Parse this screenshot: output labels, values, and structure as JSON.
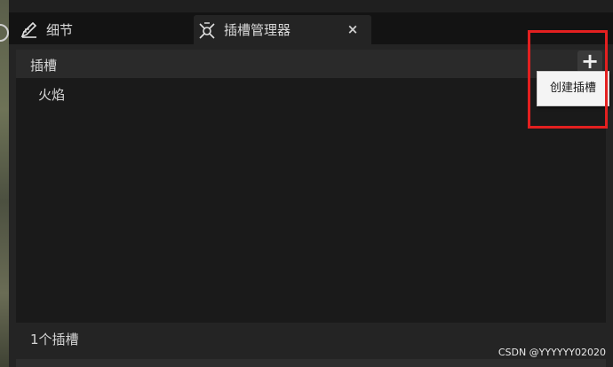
{
  "tabs": [
    {
      "label": "细节",
      "icon": "pencil-icon"
    },
    {
      "label": "插槽管理器",
      "icon": "socket-manager-icon",
      "close": "×"
    }
  ],
  "panel": {
    "header": {
      "title": "插槽",
      "add_button": "+"
    },
    "list": {
      "items": [
        "火焰"
      ]
    },
    "footer": {
      "count_text": "1个插槽"
    }
  },
  "tooltip": {
    "text": "创建插槽"
  },
  "watermark": "CSDN @YYYYYY02020",
  "colors": {
    "highlight": "#e32020",
    "background": "#242424"
  }
}
